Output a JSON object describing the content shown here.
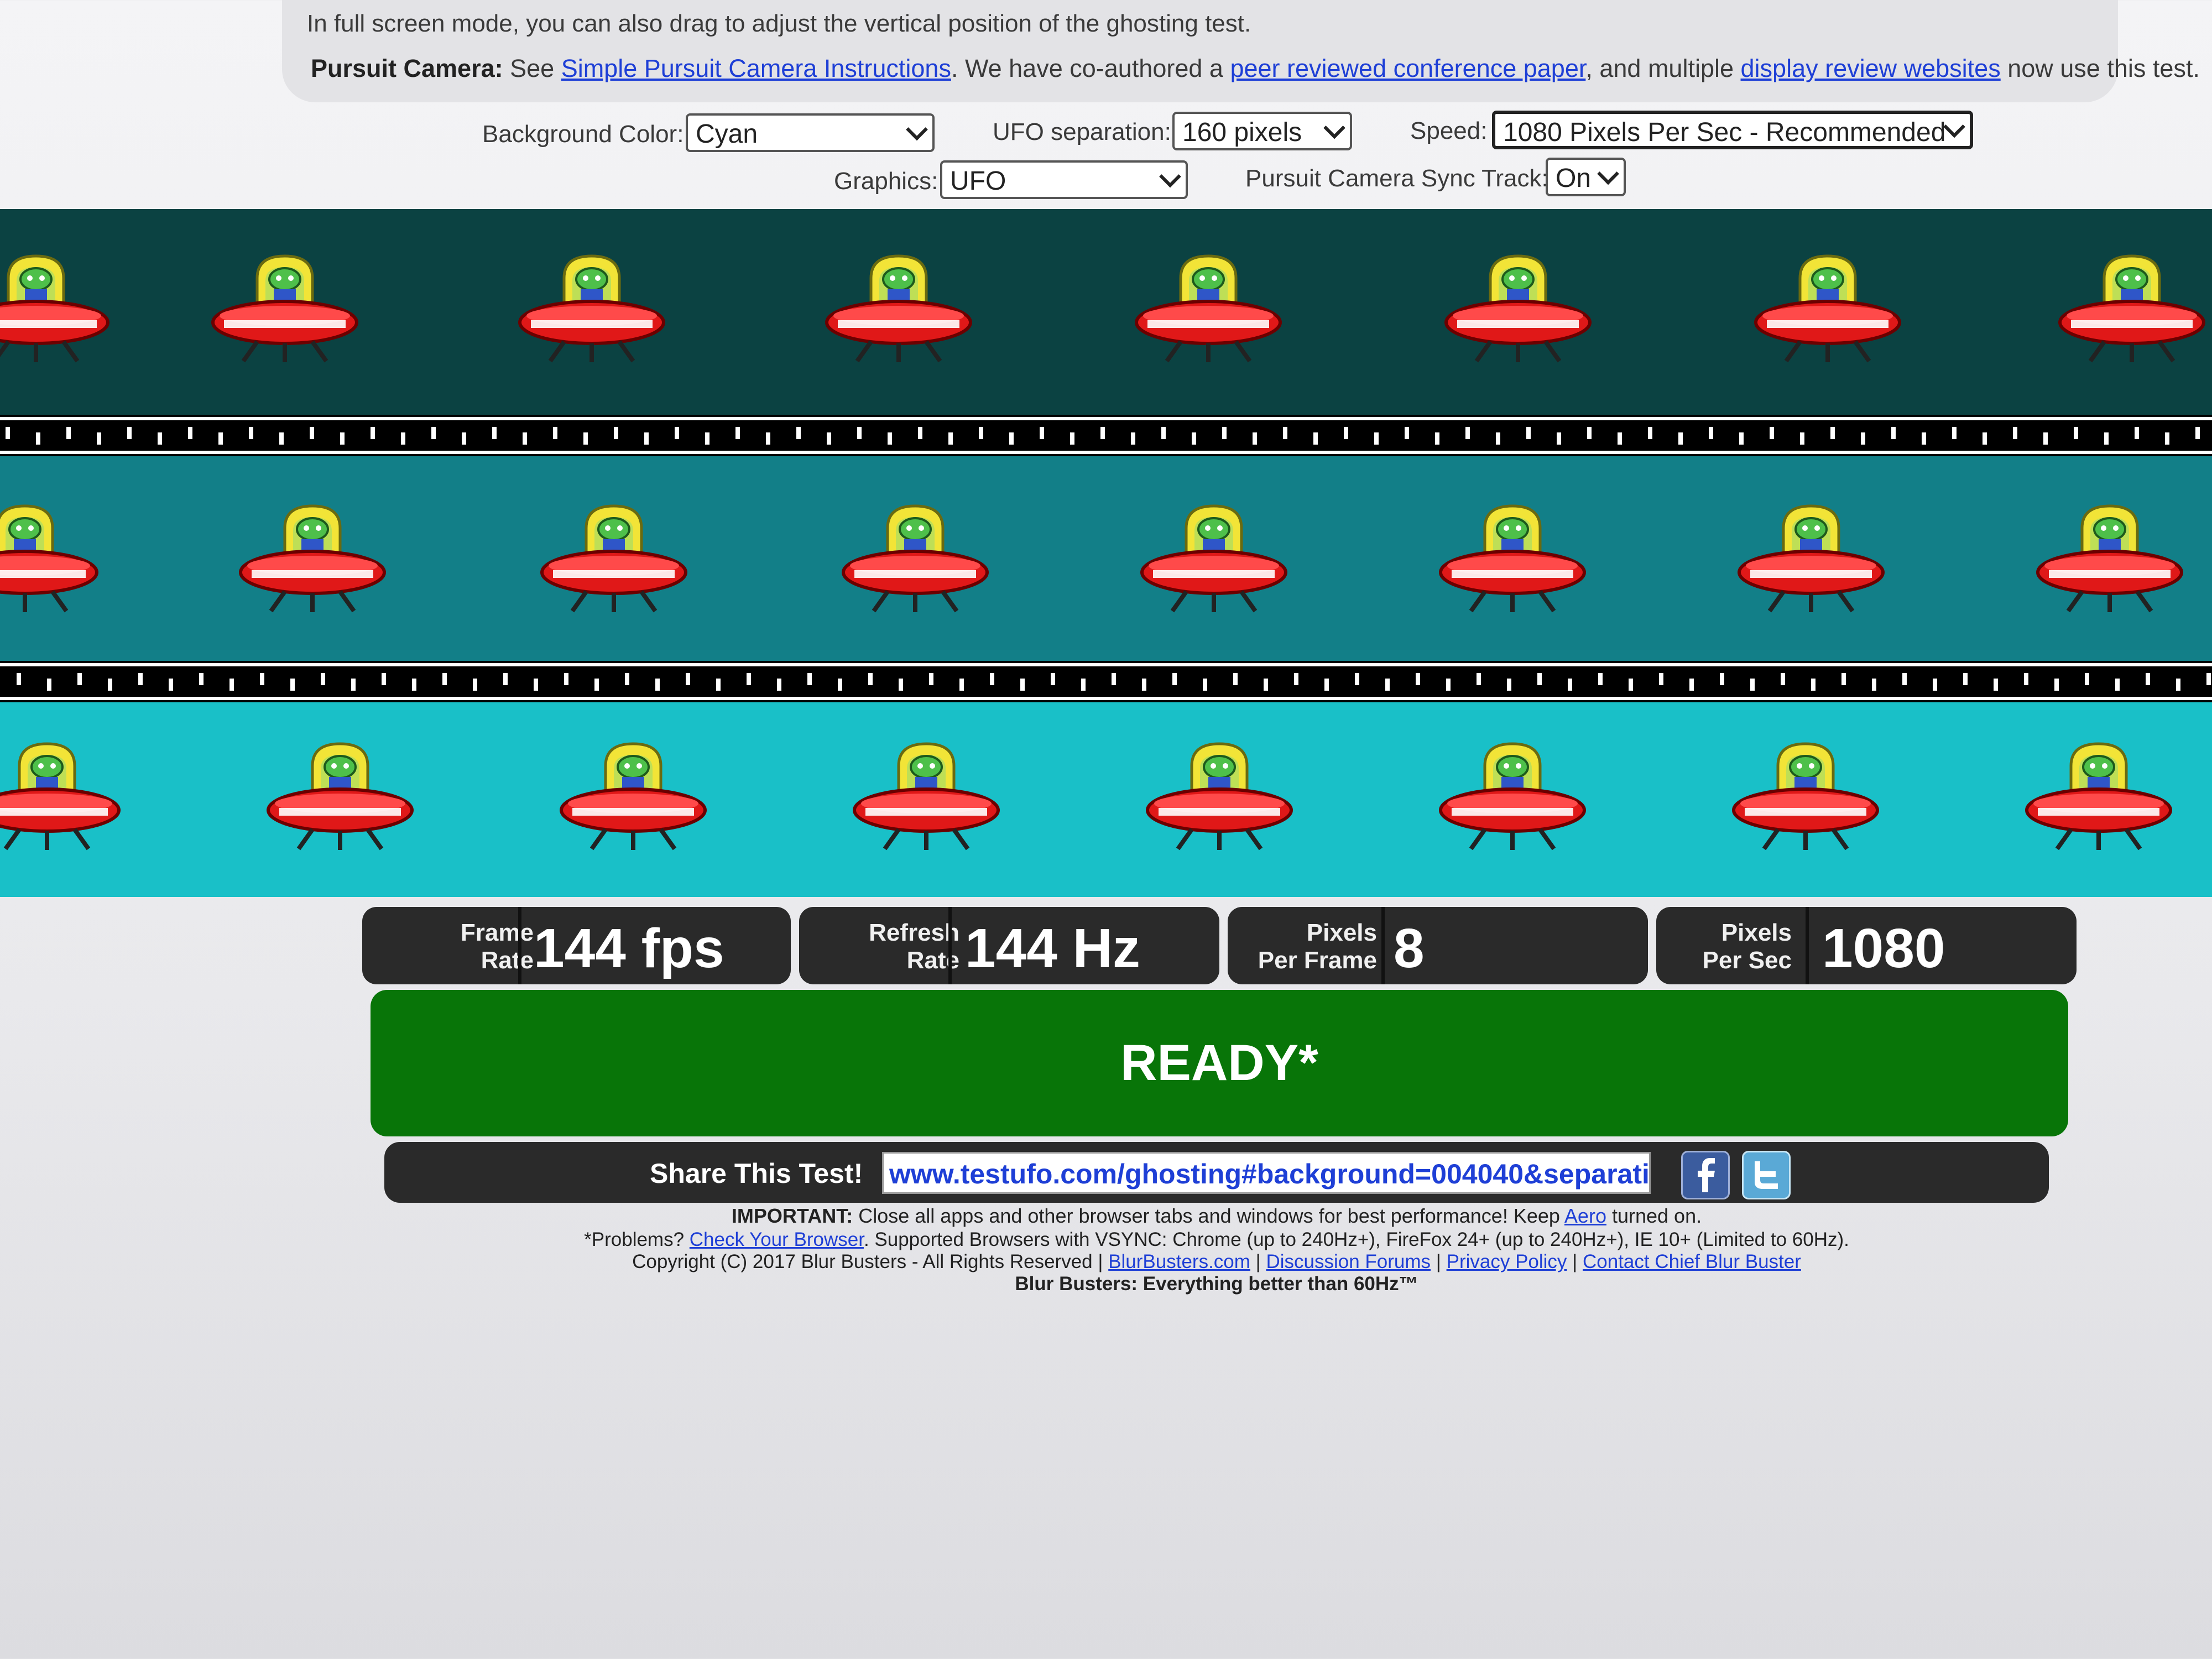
{
  "info": {
    "line1": "In full screen mode, you can also drag to adjust the vertical position of the ghosting test.",
    "pursuit_bold": "Pursuit Camera:",
    "pursuit_see": " See ",
    "link_instructions": "Simple Pursuit Camera Instructions",
    "pursuit_mid": ". We have co-authored a ",
    "link_paper": "peer reviewed conference paper",
    "pursuit_mid2": ", and multiple ",
    "link_reviews": "display review websites",
    "pursuit_end": " now use this test."
  },
  "controls": {
    "background_label": "Background Color:",
    "background_value": "Cyan",
    "separation_label": "UFO separation:",
    "separation_value": "160 pixels",
    "speed_label": "Speed:",
    "speed_value": "1080 Pixels Per Sec - Recommended",
    "graphics_label": "Graphics:",
    "graphics_value": "UFO",
    "sync_label": "Pursuit Camera Sync Track:",
    "sync_value": "On"
  },
  "lanes": {
    "colors": [
      "#0b4242",
      "#127f88",
      "#19c0c8"
    ],
    "sync_color": "#000000"
  },
  "stats": {
    "frame_rate_label1": "Frame",
    "frame_rate_label2": "Rate",
    "frame_rate_value": "144 fps",
    "refresh_label1": "Refresh",
    "refresh_label2": "Rate",
    "refresh_value": "144 Hz",
    "ppf_label1": "Pixels",
    "ppf_label2": "Per Frame",
    "ppf_value": "8",
    "pps_label1": "Pixels",
    "pps_label2": "Per Sec",
    "pps_value": "1080"
  },
  "status": {
    "text": "READY*",
    "color": "#087508"
  },
  "share": {
    "label": "Share This Test!",
    "url": "www.testufo.com/ghosting#background=004040&separati",
    "facebook_icon": "facebook-icon",
    "twitter_icon": "twitter-icon"
  },
  "footer": {
    "important_bold": "IMPORTANT:",
    "important_text": " Close all apps and other browser tabs and windows for best performance! Keep ",
    "link_aero": "Aero",
    "important_end": " turned on.",
    "problems_prefix": "*Problems? ",
    "link_check_browser": "Check Your Browser",
    "problems_text": ". Supported Browsers with VSYNC: Chrome (up to 240Hz+), FireFox 24+ (up to 240Hz+), IE 10+ (Limited to 60Hz).",
    "copyright": "Copyright (C) 2017 Blur Busters - All Rights Reserved | ",
    "link_blurbusters": "BlurBusters.com",
    "sep": " | ",
    "link_forums": "Discussion Forums",
    "link_privacy": "Privacy Policy",
    "link_contact": "Contact Chief Blur Buster",
    "tagline": "Blur Busters: Everything better than 60Hz™"
  }
}
